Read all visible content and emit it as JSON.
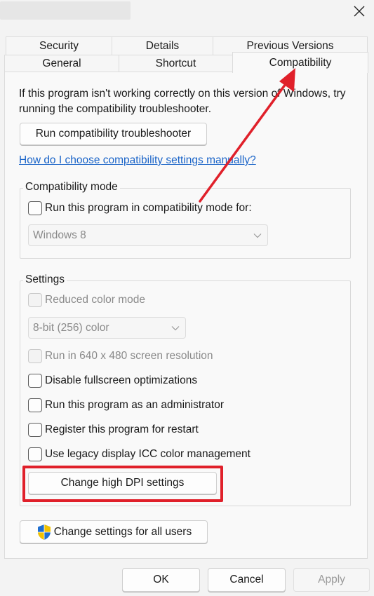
{
  "window": {
    "close_icon": "close-icon"
  },
  "tabs": {
    "row_back": [
      "Security",
      "Details",
      "Previous Versions"
    ],
    "row_front": [
      "General",
      "Shortcut",
      "Compatibility"
    ],
    "active": "Compatibility"
  },
  "intro": {
    "line1": "If this program isn't working correctly on this version of Windows, try",
    "line2": "running the compatibility troubleshooter.",
    "troubleshooter_button": "Run compatibility troubleshooter",
    "manual_link": "How do I choose compatibility settings manually?"
  },
  "compatibility_mode": {
    "group_label": "Compatibility mode",
    "checkbox_label": "Run this program in compatibility mode for:",
    "checked": false,
    "os_select_value": "Windows 8",
    "os_select_enabled": false
  },
  "settings": {
    "group_label": "Settings",
    "reduced_color_label": "Reduced color mode",
    "color_select_value": "8-bit (256) color",
    "resolution_label": "Run in 640 x 480 screen resolution",
    "fullscreen_label": "Disable fullscreen optimizations",
    "admin_label": "Run this program as an administrator",
    "restart_label": "Register this program for restart",
    "icc_label": "Use legacy display ICC color management",
    "dpi_button": "Change high DPI settings"
  },
  "all_users_button": "Change settings for all users",
  "footer": {
    "ok": "OK",
    "cancel": "Cancel",
    "apply": "Apply"
  },
  "colors": {
    "highlight": "#e0202a",
    "arrow": "#e0202a",
    "link": "#1a64c8"
  }
}
